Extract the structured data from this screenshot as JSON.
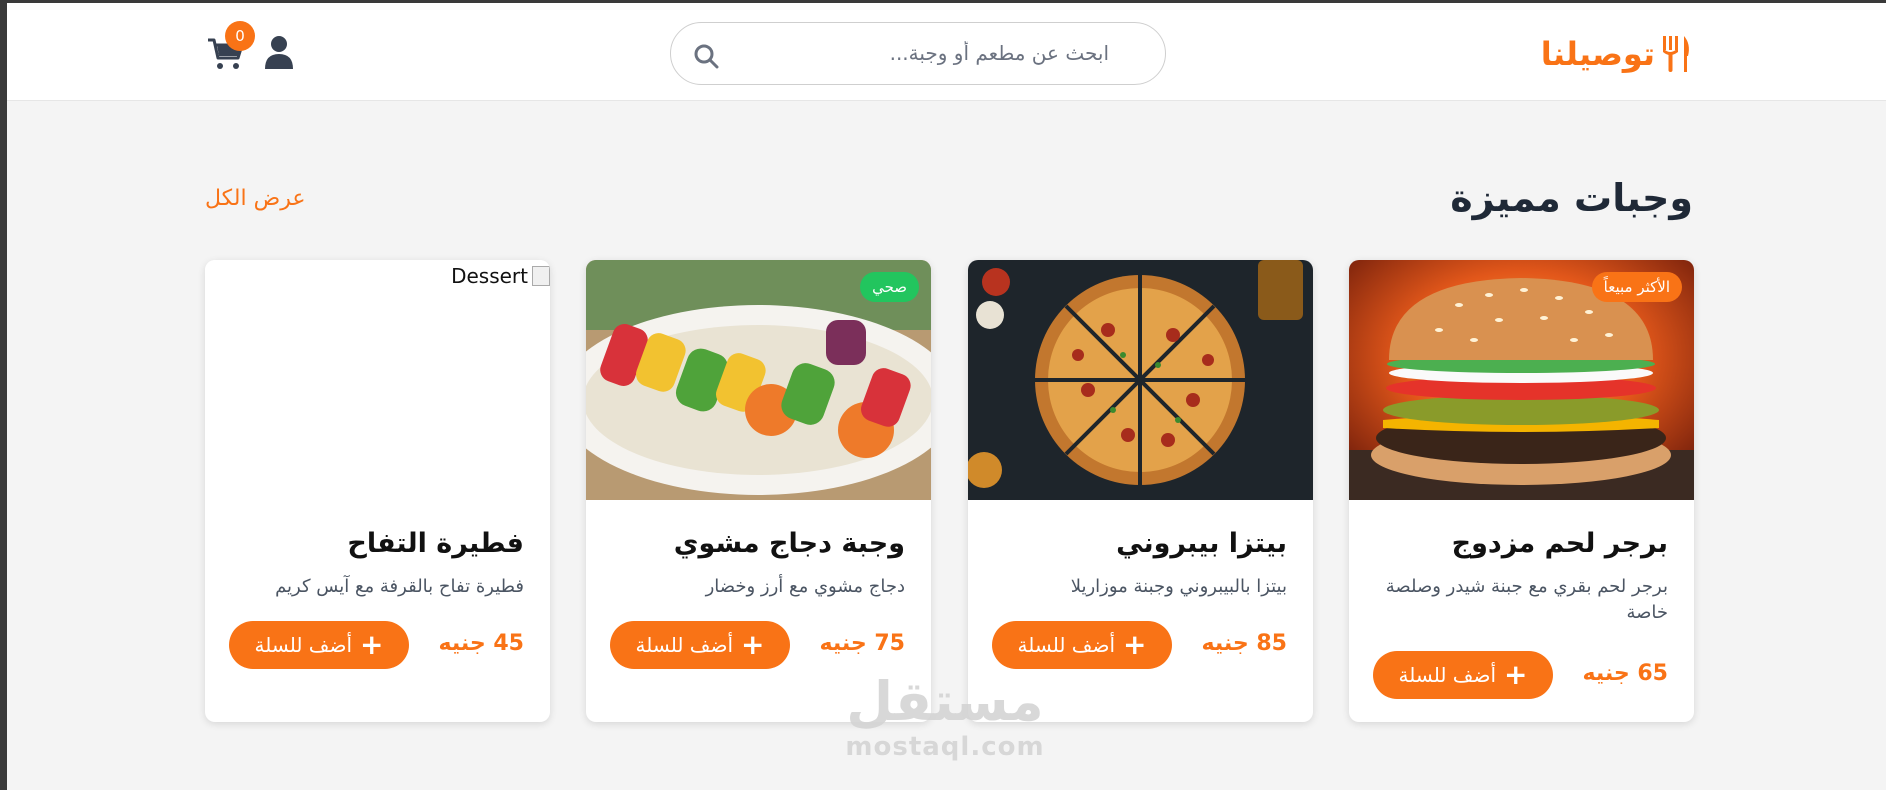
{
  "header": {
    "logo_text": "توصيلنا",
    "search_placeholder": "ابحث عن مطعم أو وجبة...",
    "cart_count": "0"
  },
  "section": {
    "title": "وجبات مميزة",
    "view_all": "عرض الكل"
  },
  "cards": [
    {
      "title": "برجر لحم مزدوج",
      "desc": "برجر لحم بقري مع جبنة شيدر وصلصة خاصة",
      "price": "65 جنيه",
      "badge": "الأكثر مبيعاً",
      "button": "أضف للسلة"
    },
    {
      "title": "بيتزا بيبروني",
      "desc": "بيتزا بالبيبروني وجبنة موزاريلا",
      "price": "85 جنيه",
      "button": "أضف للسلة"
    },
    {
      "title": "وجبة دجاج مشوي",
      "desc": "دجاج مشوي مع أرز وخضار",
      "price": "75 جنيه",
      "badge": "صحي",
      "button": "أضف للسلة"
    },
    {
      "title": "فطيرة التفاح",
      "desc": "فطيرة تفاح بالقرفة مع آيس كريم",
      "price": "45 جنيه",
      "button": "أضف للسلة",
      "image_alt": "Dessert"
    }
  ],
  "colors": {
    "accent": "#f97316",
    "healthy": "#22c55e",
    "dark": "#1f2937"
  },
  "watermark": {
    "main": "مستقل",
    "sub": "mostaql.com"
  }
}
